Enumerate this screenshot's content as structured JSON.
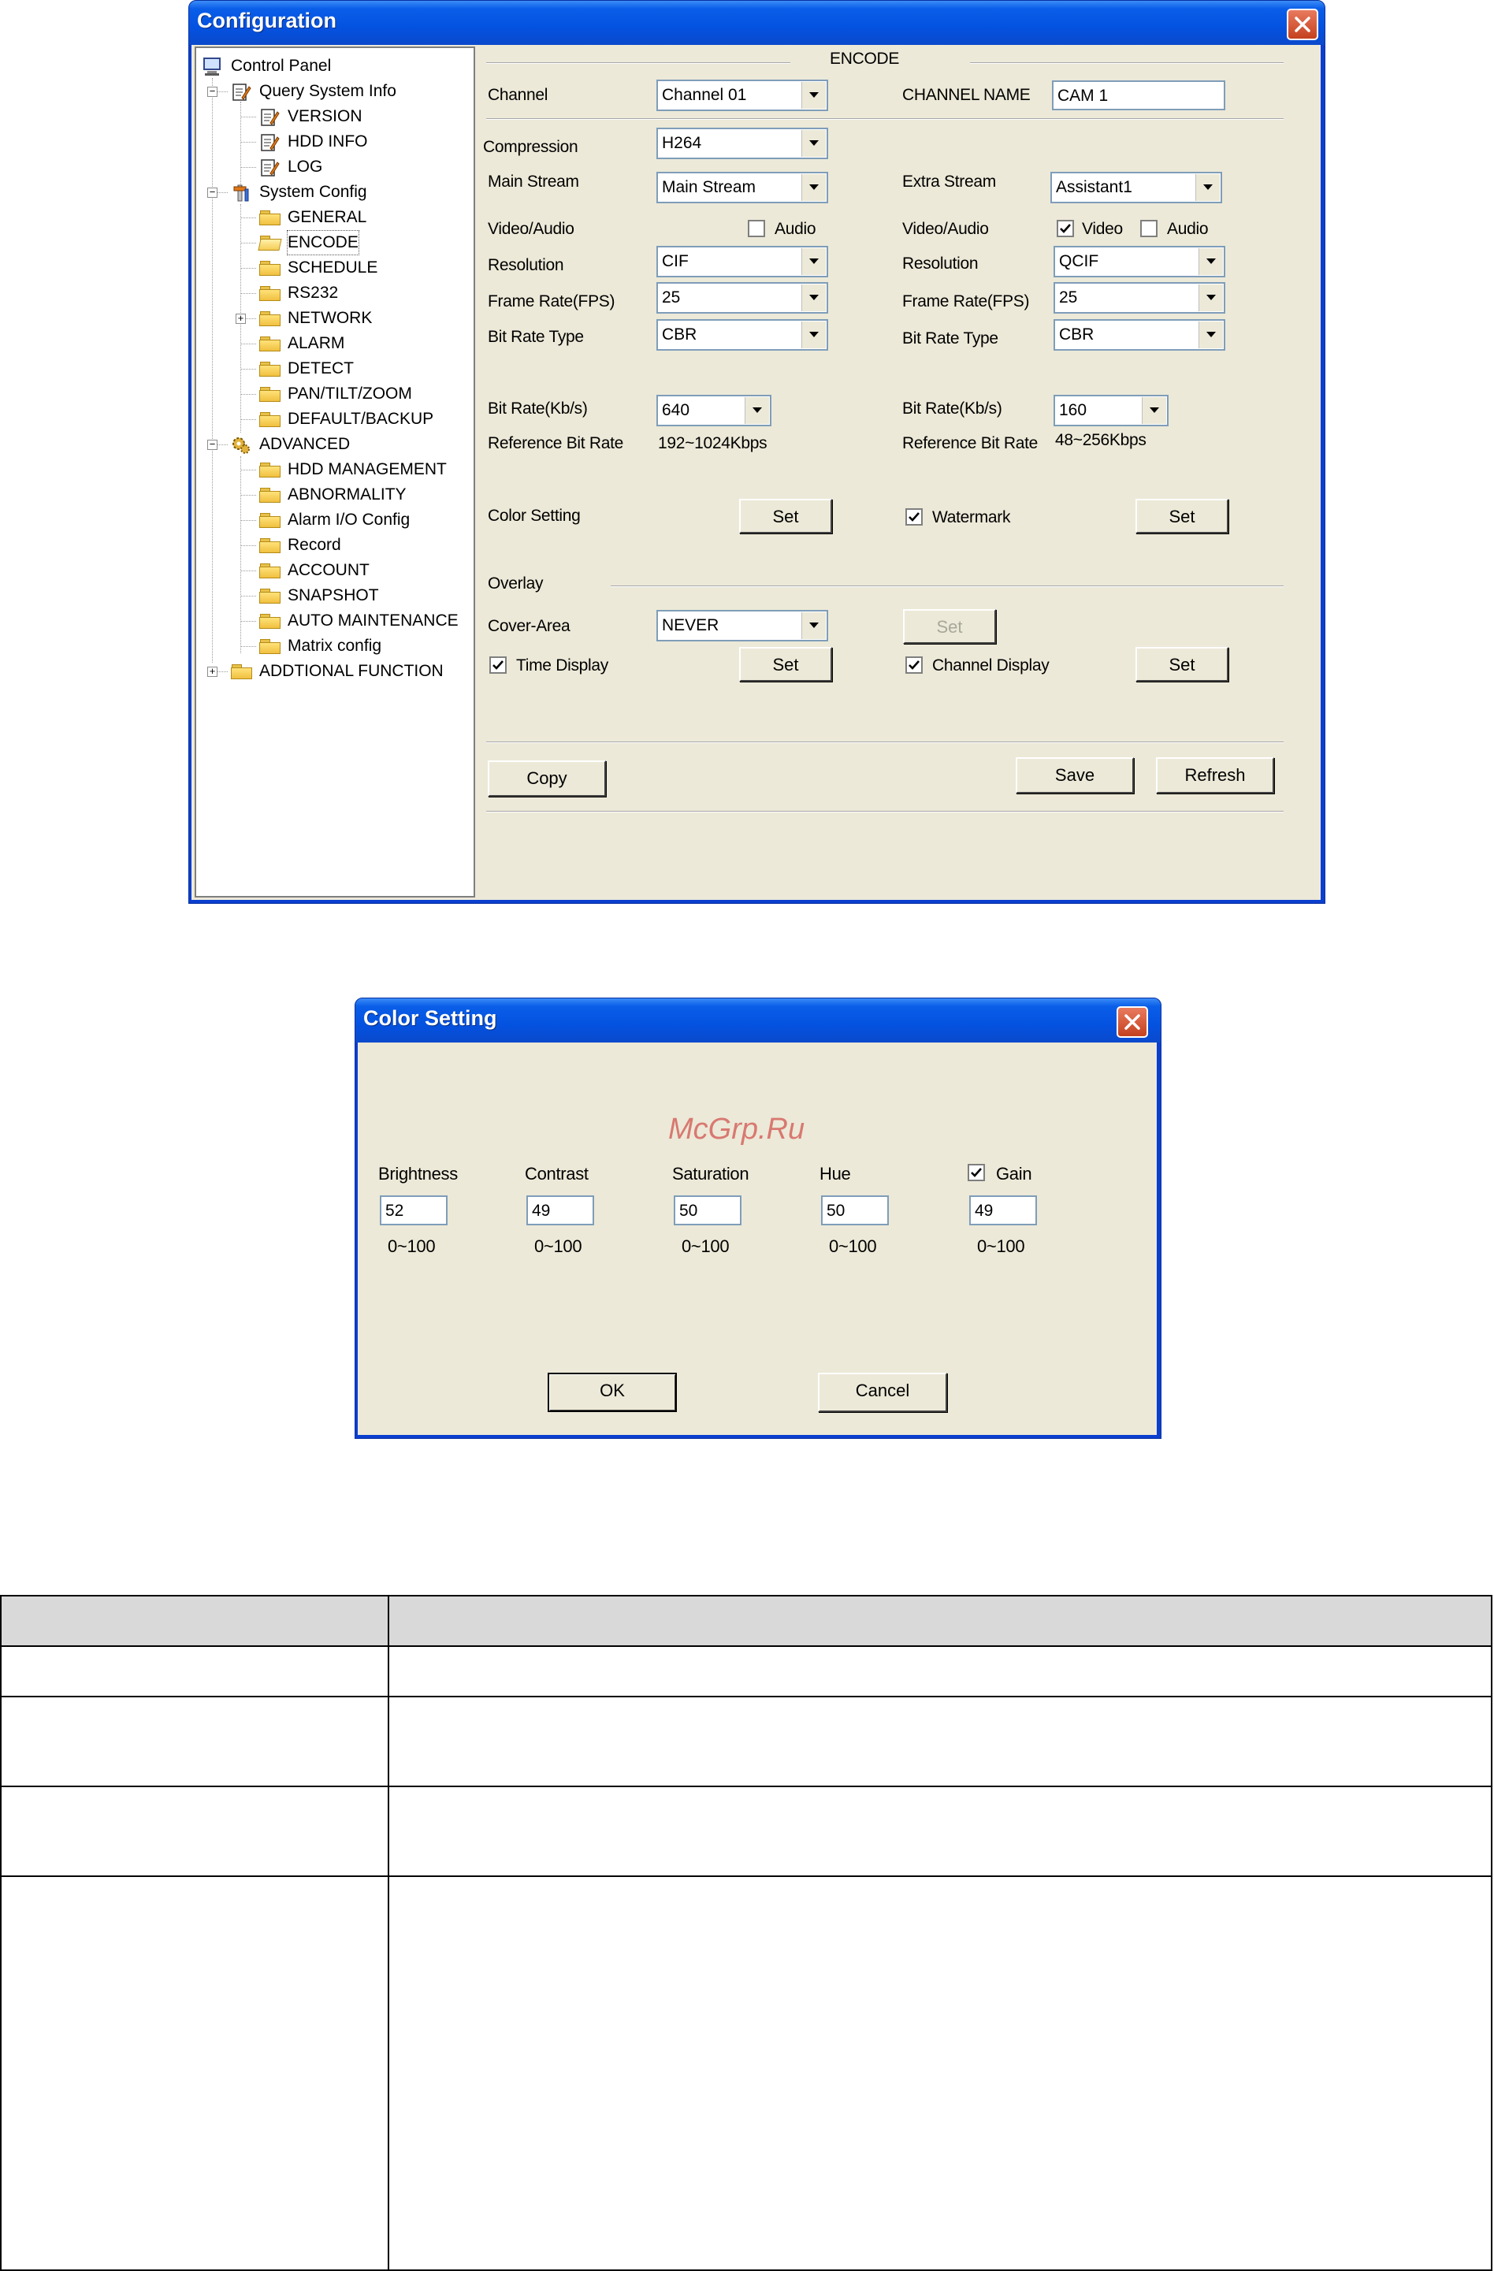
{
  "config_window": {
    "title": "Configuration",
    "tree": {
      "items": [
        {
          "label": "Control Panel",
          "icon": "computer-icon"
        },
        {
          "label": "Query System Info",
          "icon": "document-icon"
        },
        {
          "label": "VERSION",
          "icon": "document-icon"
        },
        {
          "label": "HDD INFO",
          "icon": "document-icon"
        },
        {
          "label": "LOG",
          "icon": "document-icon"
        },
        {
          "label": "System Config",
          "icon": "tools-icon"
        },
        {
          "label": "GENERAL",
          "icon": "folder-icon"
        },
        {
          "label": "ENCODE",
          "icon": "folder-open-icon"
        },
        {
          "label": "SCHEDULE",
          "icon": "folder-icon"
        },
        {
          "label": "RS232",
          "icon": "folder-icon"
        },
        {
          "label": "NETWORK",
          "icon": "folder-icon"
        },
        {
          "label": "ALARM",
          "icon": "folder-icon"
        },
        {
          "label": "DETECT",
          "icon": "folder-icon"
        },
        {
          "label": "PAN/TILT/ZOOM",
          "icon": "folder-icon"
        },
        {
          "label": "DEFAULT/BACKUP",
          "icon": "folder-icon"
        },
        {
          "label": "ADVANCED",
          "icon": "gears-icon"
        },
        {
          "label": "HDD MANAGEMENT",
          "icon": "folder-icon"
        },
        {
          "label": "ABNORMALITY",
          "icon": "folder-icon"
        },
        {
          "label": "Alarm I/O Config",
          "icon": "folder-icon"
        },
        {
          "label": "Record",
          "icon": "folder-icon"
        },
        {
          "label": "ACCOUNT",
          "icon": "folder-icon"
        },
        {
          "label": "SNAPSHOT",
          "icon": "folder-icon"
        },
        {
          "label": "AUTO MAINTENANCE",
          "icon": "folder-icon"
        },
        {
          "label": "Matrix config",
          "icon": "folder-icon"
        },
        {
          "label": "ADDTIONAL FUNCTION",
          "icon": "folder-icon"
        }
      ]
    },
    "encode": {
      "section_title": "ENCODE",
      "channel_label": "Channel",
      "channel_value": "Channel 01",
      "channel_name_label": "CHANNEL NAME",
      "channel_name_value": "CAM 1",
      "compression_label": "Compression",
      "compression_value": "H264",
      "main_stream_label": "Main Stream",
      "main_stream_value": "Main Stream",
      "extra_stream_label": "Extra Stream",
      "extra_stream_value": "Assistant1",
      "video_audio_label": "Video/Audio",
      "audio_label": "Audio",
      "video_label": "Video",
      "main_audio_checked": false,
      "extra_video_checked": true,
      "extra_audio_checked": false,
      "resolution_label": "Resolution",
      "main_resolution": "CIF",
      "extra_resolution": "QCIF",
      "frame_rate_label": "Frame Rate(FPS)",
      "main_frame_rate": "25",
      "extra_frame_rate": "25",
      "bit_rate_type_label": "Bit Rate Type",
      "main_bit_rate_type": "CBR",
      "extra_bit_rate_type": "CBR",
      "bit_rate_label": "Bit Rate(Kb/s)",
      "main_bit_rate": "640",
      "extra_bit_rate": "160",
      "ref_bit_rate_label": "Reference Bit Rate",
      "main_ref_bit_rate": "192~1024Kbps",
      "extra_ref_bit_rate": "48~256Kbps",
      "color_setting_label": "Color Setting",
      "set_label": "Set",
      "watermark_label": "Watermark",
      "watermark_checked": true,
      "overlay_label": "Overlay",
      "cover_area_label": "Cover-Area",
      "cover_area_value": "NEVER",
      "time_display_label": "Time Display",
      "time_display_checked": true,
      "channel_display_label": "Channel Display",
      "channel_display_checked": true,
      "copy_label": "Copy",
      "save_label": "Save",
      "refresh_label": "Refresh"
    }
  },
  "color_dialog": {
    "title": "Color Setting",
    "fields": [
      {
        "label": "Brightness",
        "value": "52",
        "range": "0~100"
      },
      {
        "label": "Contrast",
        "value": "49",
        "range": "0~100"
      },
      {
        "label": "Saturation",
        "value": "50",
        "range": "0~100"
      },
      {
        "label": "Hue",
        "value": "50",
        "range": "0~100"
      },
      {
        "label": "Gain",
        "value": "49",
        "range": "0~100"
      }
    ],
    "gain_checked": true,
    "ok_label": "OK",
    "cancel_label": "Cancel"
  },
  "watermark_text": "McGrp.Ru",
  "colors": {
    "titlebar": "#0452e0",
    "window_bg": "#ece9d8",
    "table_header_bg": "#d9d9d9"
  }
}
